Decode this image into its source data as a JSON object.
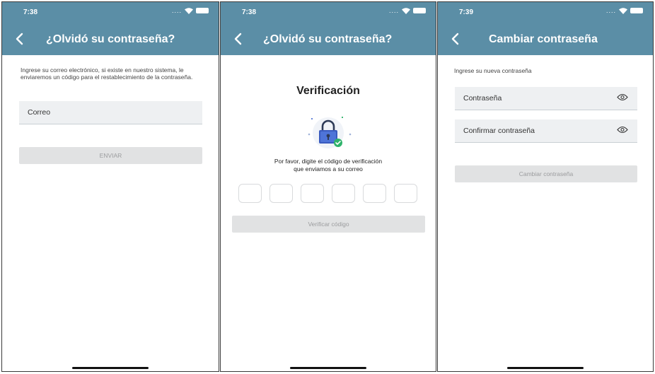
{
  "screens": [
    {
      "time": "7:38",
      "title": "¿Olvidó su contraseña?",
      "instruction": "Ingrese su correo electrónico, si existe en nuestro sistema, le enviaremos un código para el restablecimiento de la contraseña.",
      "email_placeholder": "Correo",
      "submit_label": "ENVIAR"
    },
    {
      "time": "7:38",
      "title": "¿Olvidó su contraseña?",
      "heading": "Verificación",
      "instruction_line1": "Por favor, digite el código de verificación",
      "instruction_line2": "que enviamos a su correo",
      "code_digits": 6,
      "submit_label": "Verificar código"
    },
    {
      "time": "7:39",
      "title": "Cambiar contraseña",
      "instruction": "Ingrese su nueva contraseña",
      "password_placeholder": "Contraseña",
      "confirm_placeholder": "Confirmar contraseña",
      "submit_label": "Cambiar contraseña"
    }
  ],
  "colors": {
    "header": "#5b8ea6",
    "button_disabled": "#e1e2e3",
    "field_bg": "#eef0f2"
  }
}
